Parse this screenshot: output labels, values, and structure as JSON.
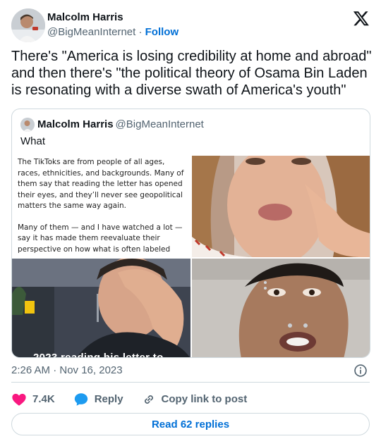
{
  "author": {
    "name": "Malcolm Harris",
    "handle": "@BigMeanInternet",
    "separator": "·",
    "follow_label": "Follow"
  },
  "tweet": {
    "text": "There's \"America is losing credibility at home and abroad\" and then there's \"the political theory of Osama Bin Laden is resonating with a diverse swath of America's youth\""
  },
  "quote": {
    "name": "Malcolm Harris",
    "handle": "@BigMeanInternet",
    "text": "What",
    "media": {
      "document_paragraph_1": "The TikToks are from people of all ages, races, ethnicities, and backgrounds. Many of them say that reading the letter has opened their eyes, and they’ll never see geopolitical matters the same way again.",
      "document_paragraph_2": "Many of them — and I have watched a lot — say it has made them reevaluate their perspective on how what is often labeled",
      "video_caption": "2023 reading his letter to"
    }
  },
  "meta": {
    "timestamp": "2:26 AM · Nov 16, 2023"
  },
  "actions": {
    "likes": "7.4K",
    "reply_label": "Reply",
    "copy_label": "Copy link to post"
  },
  "read_replies_label": "Read 62 replies",
  "colors": {
    "like_red": "#f91880",
    "reply_blue": "#1d9bf0",
    "link_blue": "#006fd6",
    "muted_gray": "#536471",
    "border_gray": "#cfd9de"
  },
  "icons": [
    "x-logo-icon",
    "info-icon",
    "heart-icon",
    "reply-bubble-icon",
    "link-icon"
  ]
}
